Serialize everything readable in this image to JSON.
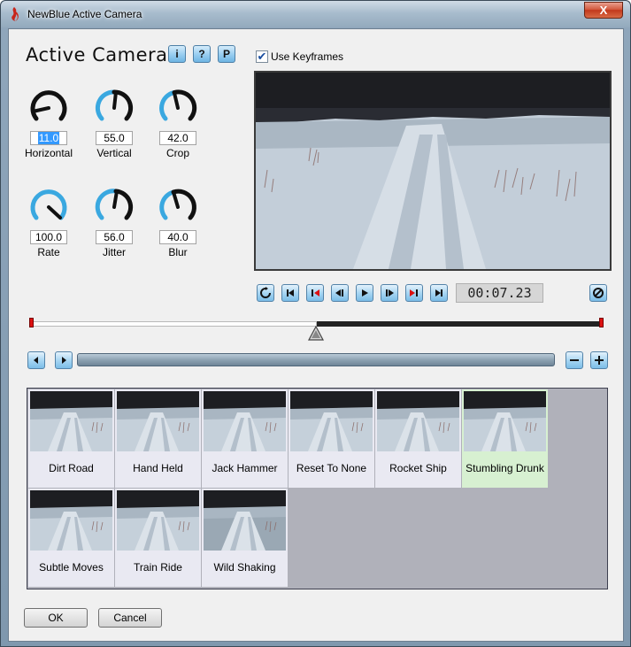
{
  "window": {
    "title": "NewBlue Active Camera",
    "close_label": "X"
  },
  "header": {
    "app_title": "Active Camera",
    "info_label": "i",
    "help_label": "?",
    "presets_label": "P",
    "use_keyframes_label": "Use Keyframes",
    "use_keyframes_checked": true
  },
  "knobs": [
    {
      "label": "Horizontal",
      "value": "11.0"
    },
    {
      "label": "Vertical",
      "value": "55.0"
    },
    {
      "label": "Crop",
      "value": "42.0"
    },
    {
      "label": "Rate",
      "value": "100.0"
    },
    {
      "label": "Jitter",
      "value": "56.0"
    },
    {
      "label": "Blur",
      "value": "40.0"
    }
  ],
  "transport": {
    "timecode": "00:07.23",
    "playhead_fraction": 0.5
  },
  "presets": [
    {
      "label": "Dirt Road"
    },
    {
      "label": "Hand Held"
    },
    {
      "label": "Jack Hammer"
    },
    {
      "label": "Reset To None"
    },
    {
      "label": "Rocket Ship"
    },
    {
      "label": "Stumbling Drunk"
    },
    {
      "label": "Subtle Moves"
    },
    {
      "label": "Train Ride"
    },
    {
      "label": "Wild Shaking"
    }
  ],
  "footer": {
    "ok_label": "OK",
    "cancel_label": "Cancel"
  },
  "colors": {
    "accent": "#3aa8e0",
    "knob_dark": "#111111",
    "selected_preset": "#d7f0d1",
    "timeline_marker": "#dd1111"
  }
}
